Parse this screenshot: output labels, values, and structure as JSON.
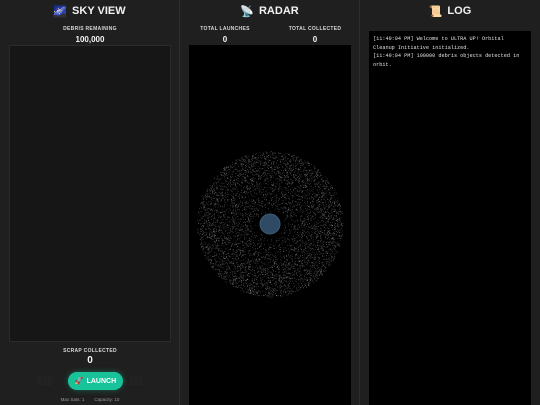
{
  "sky": {
    "title": "SKY VIEW",
    "title_icon": "galaxy-icon",
    "debris_label": "DEBRIS REMAINING",
    "debris_value": "100,000",
    "scrap_label": "SCRAP COLLECTED",
    "scrap_value": "0",
    "launch_label": "LAUNCH",
    "launch_icon": "rocket-icon",
    "max_sats": "Max Sats: 1",
    "capacity": "Capacity: 10",
    "accent_color": "#19c39a"
  },
  "radar": {
    "title": "RADAR",
    "title_icon": "satellite-dish-icon",
    "launches_label": "TOTAL LAUNCHES",
    "launches_value": "0",
    "collected_label": "TOTAL COLLECTED",
    "collected_value": "0",
    "planet_color": "#2f4a64",
    "debris_color": "#9a9a9a"
  },
  "log": {
    "title": "LOG",
    "title_icon": "scroll-icon",
    "entries": [
      "[11:49:04 PM] Welcome to ULTRA UP! Orbital Cleanup Initiative initialized.",
      "[11:49:04 PM] 100000 debris objects detected in orbit."
    ]
  }
}
